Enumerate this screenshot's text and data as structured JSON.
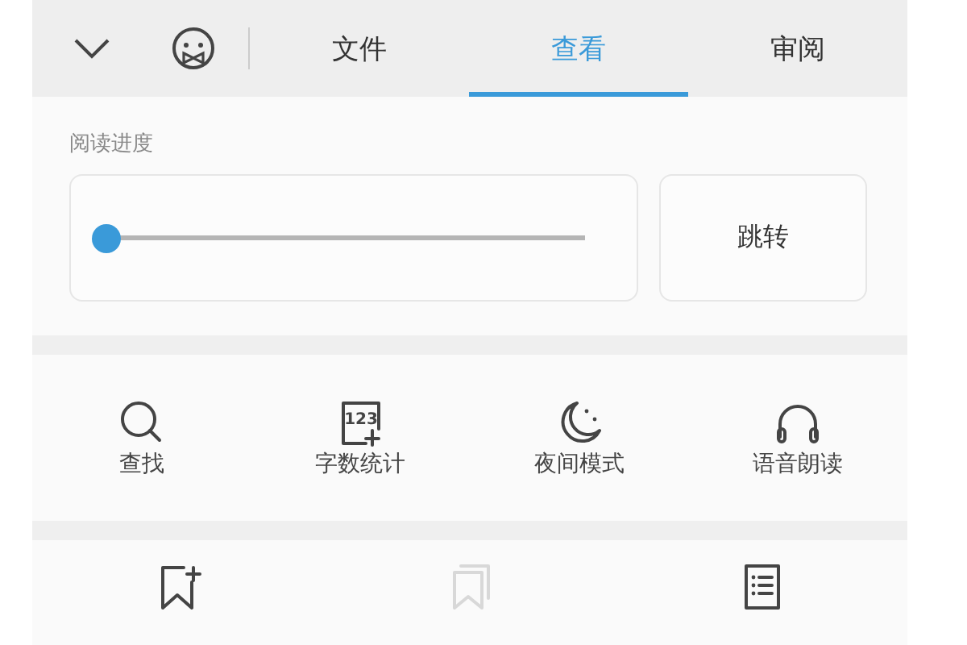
{
  "toolbar": {
    "tabs": [
      {
        "label": "文件",
        "selected": false
      },
      {
        "label": "查看",
        "selected": true
      },
      {
        "label": "审阅",
        "selected": false
      }
    ]
  },
  "progress": {
    "label": "阅读进度",
    "level": 0.0,
    "button": "跳转"
  },
  "tools": [
    {
      "kind": "search",
      "label": "查找",
      "disabled": false
    },
    {
      "kind": "count",
      "label": "字数统计",
      "icon_text": "123",
      "disabled": false
    },
    {
      "kind": "moon",
      "label": "夜间模式",
      "disabled": false
    },
    {
      "kind": "headphones",
      "label": "语音朗读",
      "disabled": false
    }
  ],
  "bookmarks": [
    {
      "kind": "bookmark-add",
      "disabled": false
    },
    {
      "kind": "bookmarks",
      "disabled": true
    },
    {
      "kind": "list",
      "disabled": false
    }
  ]
}
